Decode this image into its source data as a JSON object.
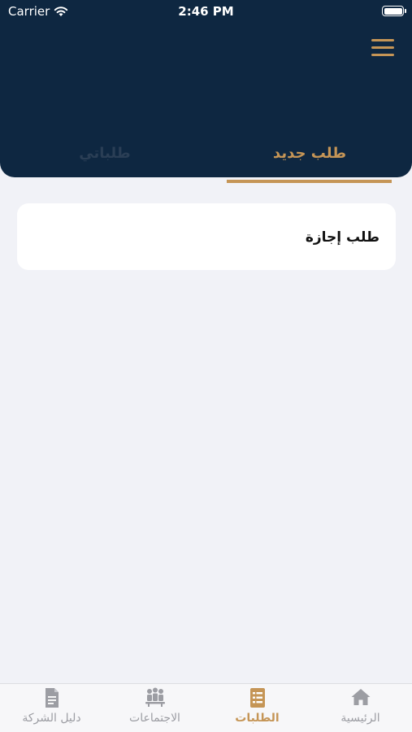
{
  "status_bar": {
    "carrier": "Carrier",
    "time": "2:46 PM"
  },
  "tabs": {
    "new_request": "طلب جديد",
    "my_requests": "طلباتي",
    "active": "new_request"
  },
  "requests": [
    {
      "label": "طلب إجازة"
    }
  ],
  "tab_bar": {
    "items": [
      {
        "label": "الرئيسية",
        "icon": "home-icon"
      },
      {
        "label": "الطلبات",
        "icon": "requests-icon",
        "active": true
      },
      {
        "label": "الاجتماعات",
        "icon": "meetings-icon"
      },
      {
        "label": "دليل الشركة",
        "icon": "document-icon"
      }
    ]
  },
  "colors": {
    "header": "#0e2741",
    "accent": "#c59556",
    "background": "#f1f2f7",
    "inactive": "#9c9da3"
  }
}
